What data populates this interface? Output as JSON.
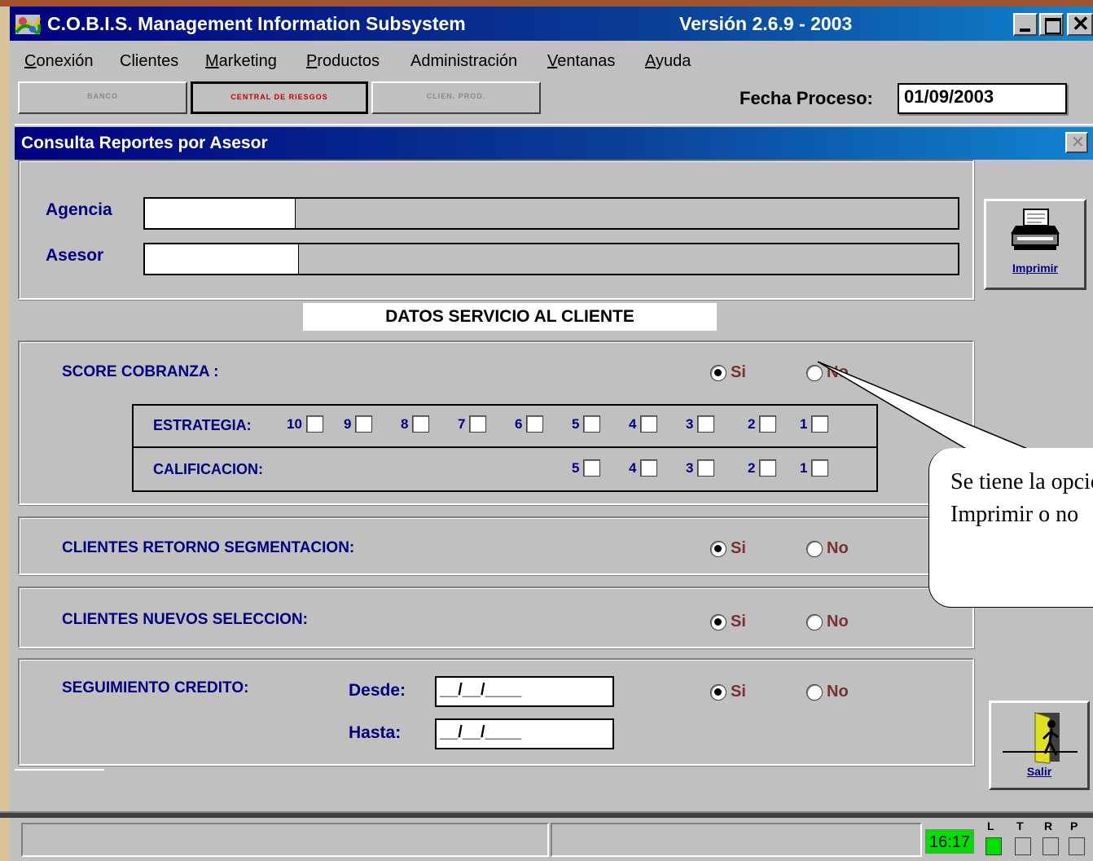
{
  "app": {
    "title": "C.O.B.I.S. Management Information Subsystem",
    "version": "Versión 2.6.9 - 2003"
  },
  "menu": [
    {
      "first": "C",
      "rest": "onexión"
    },
    {
      "first": "C",
      "rest": "lientes",
      "underline_index": 1
    },
    {
      "first": "M",
      "rest": "arketing"
    },
    {
      "first": "P",
      "rest": "roductos"
    },
    {
      "first": "A",
      "rest": "dministración"
    },
    {
      "first": "V",
      "rest": "entanas"
    },
    {
      "first": "A",
      "rest": "yuda"
    }
  ],
  "toolbar": {
    "buttons": [
      "BANCO",
      "CENTRAL DE RIESGOS",
      "CLIEN. PROD."
    ],
    "fecha_label": "Fecha Proceso:",
    "fecha_value": "01/09/2003"
  },
  "dialog": {
    "title": "Consulta Reportes por Asesor",
    "agencia_label": "Agencia",
    "asesor_label": "Asesor",
    "print_label": "Imprimir",
    "exit_label": "Salir",
    "section_title": "DATOS SERVICIO AL CLIENTE",
    "score": {
      "label": "SCORE COBRANZA :",
      "si": "Si",
      "no": "No",
      "selected": "si",
      "estrategia_label": "ESTRATEGIA:",
      "estrategia_options": [
        "10",
        "9",
        "8",
        "7",
        "6",
        "5",
        "4",
        "3",
        "2",
        "1"
      ],
      "calificacion_label": "CALIFICACION:",
      "calificacion_options": [
        "5",
        "4",
        "3",
        "2",
        "1"
      ]
    },
    "retorno": {
      "label": "CLIENTES RETORNO SEGMENTACION:",
      "si": "Si",
      "no": "No",
      "selected": "si"
    },
    "nuevos": {
      "label": "CLIENTES NUEVOS SELECCION:",
      "si": "Si",
      "no": "No",
      "selected": "si"
    },
    "seguimiento": {
      "label": "SEGUIMIENTO CREDITO:",
      "desde_label": "Desde:",
      "hasta_label": "Hasta:",
      "desde_value": "__/__/____",
      "hasta_value": "__/__/____",
      "si": "Si",
      "no": "No",
      "selected": "si"
    }
  },
  "callout": {
    "text": "Se tiene la opcion de Imprimir o no"
  },
  "status": {
    "time": "16:17",
    "indicators": [
      "L",
      "T",
      "R",
      "P"
    ]
  },
  "colors": {
    "titlebar_start": "#000080",
    "titlebar_end": "#1084d0",
    "label_navy": "#000080",
    "radio_text": "#7a3030",
    "clock_bg": "#00e000"
  }
}
